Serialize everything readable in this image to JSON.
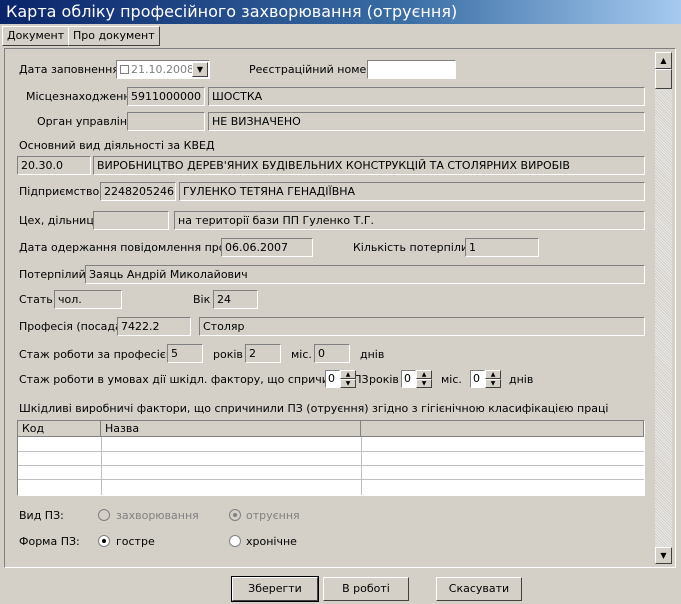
{
  "window": {
    "title": "Карта обліку професійного захворювання (отруєння)"
  },
  "toolbar": {
    "document": "Документ",
    "about": "Про документ"
  },
  "form": {
    "fill_date_label": "Дата заповнення",
    "fill_date_value": "21.10.2008",
    "reg_number_label": "Реєстраційний номер",
    "reg_number_value": "",
    "location_label": "Місцезнаходження",
    "location_code": "5911000000",
    "location_name": "ШОСТКА",
    "authority_label": "Орган управління",
    "authority_code": "",
    "authority_name": "НЕ ВИЗНАЧЕНО",
    "kved_label": "Основний вид діяльності за КВЕД",
    "kved_code": "20.30.0",
    "kved_name": "ВИРОБНИЦТВО ДЕРЕВ'ЯНИХ БУДІВЕЛЬНИХ КОНСТРУКЦІЙ ТА СТОЛЯРНИХ ВИРОБІВ",
    "enterprise_label": "Підприємство",
    "enterprise_code": "2248205246",
    "enterprise_name": "ГУЛЕНКО ТЕТЯНА ГЕНАДІЇВНА",
    "shop_label": "Цех, дільниця",
    "shop_code": "",
    "shop_name": "на території бази ПП Гуленко Т.Г.",
    "notice_date_label": "Дата одержання повідомлення про ПЗ",
    "notice_date_value": "06.06.2007",
    "victims_label": "Кількість потерпілих",
    "victims_value": "1",
    "victim_label": "Потерпілий",
    "victim_name": "Заяць Андрій Миколайович",
    "sex_label": "Стать",
    "sex_value": "чол.",
    "age_label": "Вік",
    "age_value": "24",
    "profession_label": "Професія (посада)",
    "profession_code": "7422.2",
    "profession_name": "Столяр",
    "exp_label": "Стаж роботи за професією",
    "exp_years": "5",
    "exp_months": "2",
    "exp_days": "0",
    "years_word": "років",
    "months_word": "міс.",
    "days_word": "днів",
    "harm_exp_label": "Стаж роботи в умовах дії шкідл. фактору, що спричинив ПЗ",
    "harm_years": "0",
    "harm_months": "0",
    "harm_days": "0",
    "factors_label": "Шкідливі виробничі фактори, що спричинили ПЗ (отруєння) згідно з гігієнічною класифікацією праці",
    "factors_columns": [
      "Код",
      "Назва",
      ""
    ],
    "kind_label": "Вид ПЗ:",
    "kind_options": [
      "захворювання",
      "отруєння"
    ],
    "form_label": "Форма ПЗ:",
    "form_options": [
      "гостре",
      "хронічне"
    ]
  },
  "buttons": {
    "save": "Зберегти",
    "in_work": "В роботі",
    "cancel": "Скасувати"
  },
  "icons": {
    "dropdown": "dropdown-arrow-icon",
    "scroll_up": "scroll-up-icon",
    "scroll_down": "scroll-down-icon"
  }
}
